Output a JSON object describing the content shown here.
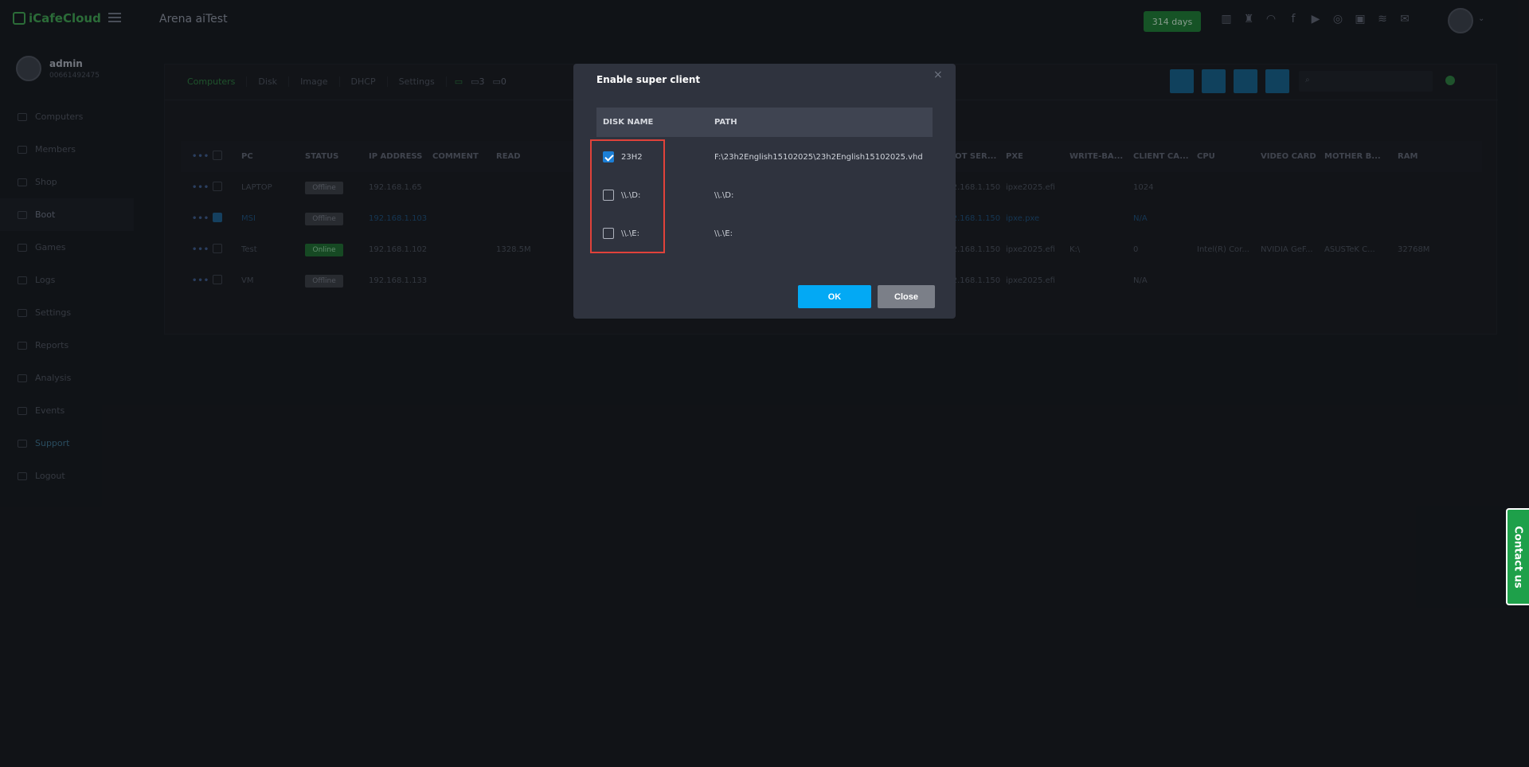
{
  "topbar": {
    "logo": "iCafeCloud",
    "site_title": "Arena aiTest",
    "days_badge": "314 days",
    "social_icons": [
      "leaderboard-icon",
      "trophy-icon",
      "rss-icon",
      "facebook-icon",
      "youtube-icon",
      "globe-icon",
      "register-icon",
      "handshake-icon",
      "mail-icon"
    ]
  },
  "sidebar": {
    "user_name": "admin",
    "user_id": "00661492475",
    "items": [
      {
        "label": "Computers",
        "icon": "monitor-icon"
      },
      {
        "label": "Members",
        "icon": "users-icon"
      },
      {
        "label": "Shop",
        "icon": "cart-icon"
      },
      {
        "label": "Boot",
        "icon": "windows-icon"
      },
      {
        "label": "Games",
        "icon": "gamepad-icon"
      },
      {
        "label": "Logs",
        "icon": "list-icon"
      },
      {
        "label": "Settings",
        "icon": "gear-icon"
      },
      {
        "label": "Reports",
        "icon": "chart-icon"
      },
      {
        "label": "Analysis",
        "icon": "analysis-icon"
      },
      {
        "label": "Events",
        "icon": "events-icon"
      },
      {
        "label": "Support",
        "icon": "phone-icon"
      },
      {
        "label": "Logout",
        "icon": "logout-icon"
      }
    ]
  },
  "main": {
    "tabs": [
      "Computers",
      "Disk",
      "Image",
      "DHCP",
      "Settings"
    ],
    "view_counts": [
      "",
      "3",
      "0"
    ],
    "search_placeholder": "Search...",
    "columns": [
      "PC",
      "STATUS",
      "IP ADDRESS",
      "COMMENT",
      "READ",
      "BOOT SER...",
      "PXE",
      "WRITE-BA...",
      "CLIENT CA...",
      "CPU",
      "VIDEO CARD",
      "MOTHER B...",
      "RAM"
    ],
    "rows": [
      {
        "pc": "LAPTOP",
        "status": "Offline",
        "ip": "192.168.1.65",
        "comment": "",
        "read": "",
        "boot": "192.168.1.150",
        "pxe": "ipxe2025.efi",
        "wb": "",
        "cc": "1024",
        "cpu": "",
        "vc": "",
        "mb": "",
        "ram": "",
        "checked": false
      },
      {
        "pc": "MSI",
        "status": "Offline",
        "ip": "192.168.1.103",
        "comment": "",
        "read": "",
        "boot": "192.168.1.150",
        "pxe": "ipxe.pxe",
        "wb": "",
        "cc": "N/A",
        "cpu": "",
        "vc": "",
        "mb": "",
        "ram": "",
        "checked": true
      },
      {
        "pc": "Test",
        "status": "Online",
        "ip": "192.168.1.102",
        "comment": "",
        "read": "1328.5M",
        "boot": "192.168.1.150",
        "pxe": "ipxe2025.efi",
        "wb": "K:\\",
        "cc": "0",
        "cpu": "Intel(R) Cor...",
        "vc": "NVIDIA GeF...",
        "mb": "ASUSTeK C...",
        "ram": "32768M",
        "checked": false
      },
      {
        "pc": "VM",
        "status": "Offline",
        "ip": "192.168.1.133",
        "comment": "",
        "read": "",
        "boot": "192.168.1.150",
        "pxe": "ipxe2025.efi",
        "wb": "",
        "cc": "N/A",
        "cpu": "",
        "vc": "",
        "mb": "",
        "ram": "",
        "checked": false
      }
    ]
  },
  "modal": {
    "title": "Enable super client",
    "close_glyph": "×",
    "col_name": "DISK NAME",
    "col_path": "PATH",
    "disks": [
      {
        "name": "23H2",
        "path": "F:\\23h2English15102025\\23h2English15102025.vhd",
        "checked": true
      },
      {
        "name": "\\\\.\\D:",
        "path": "\\\\.\\D:",
        "checked": false
      },
      {
        "name": "\\\\.\\E:",
        "path": "\\\\.\\E:",
        "checked": false
      }
    ],
    "ok_label": "OK",
    "close_label": "Close"
  },
  "contact_label": "Contact us",
  "colors": {
    "accent": "#03a9f4",
    "success": "#1ea04a",
    "highlight": "#e0423a"
  }
}
